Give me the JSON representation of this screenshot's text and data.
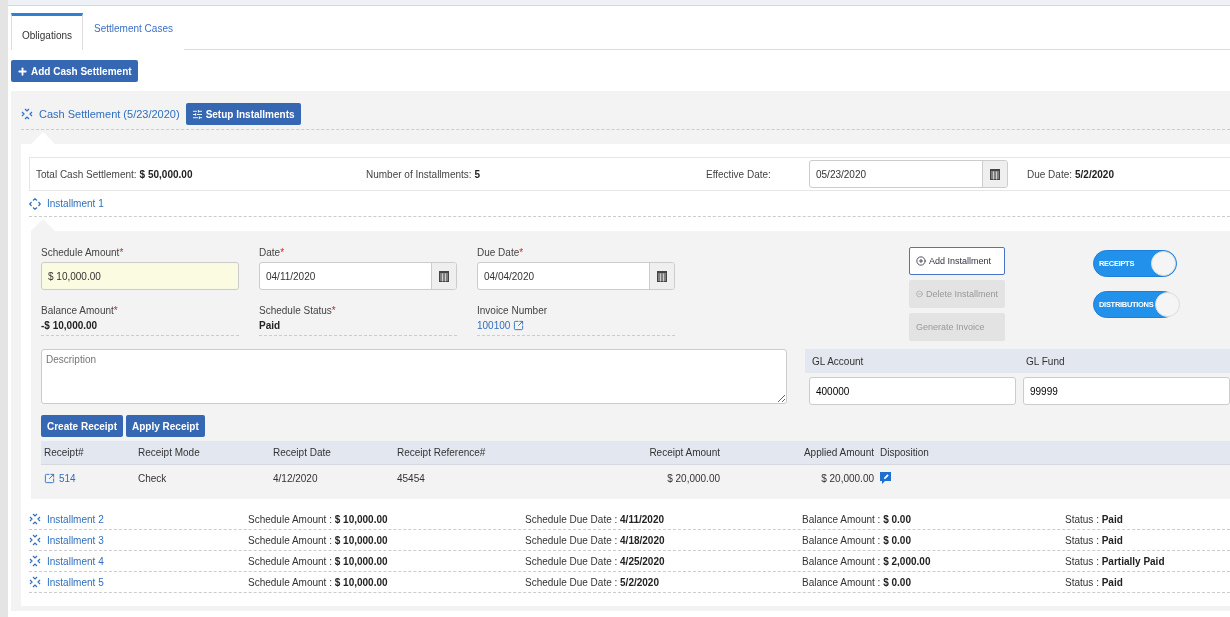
{
  "tabs": [
    {
      "label": "Obligations",
      "selected": true
    },
    {
      "label": "Settlement Cases",
      "selected": false
    }
  ],
  "add_button": "Add Cash Settlement",
  "settlement": {
    "title": "Cash Settlement (5/23/2020)",
    "setup_button": "Setup Installments",
    "summary": [
      {
        "kind": "text",
        "label": "Total Cash Settlement:",
        "value": "$ 50,000.00"
      },
      {
        "kind": "text",
        "label": "Number of Installments:",
        "value": "5"
      },
      {
        "kind": "date",
        "label": "Effective Date:",
        "value": "05/23/2020"
      },
      {
        "kind": "text",
        "label": "Due Date:",
        "value": "5/2/2020"
      }
    ]
  },
  "installments": [
    {
      "title": "Installment 1",
      "expanded": true,
      "fields": [
        {
          "kind": "amount",
          "label": "Schedule Amount",
          "required_mark": "*",
          "value": "$ 10,000.00"
        },
        {
          "kind": "date",
          "label": "Date",
          "required_mark": "*",
          "value": "04/11/2020"
        },
        {
          "kind": "date",
          "label": "Due Date",
          "required_mark": "*",
          "value": "04/04/2020"
        },
        {
          "kind": "text",
          "label": "Balance Amount",
          "required_mark": "*",
          "value": "-$ 10,000.00"
        },
        {
          "kind": "text",
          "label": "Schedule Status",
          "required_mark": "*",
          "value": "Paid"
        },
        {
          "kind": "link",
          "label": "Invoice Number",
          "value": "100100"
        }
      ],
      "description_placeholder": "Description",
      "actions": [
        {
          "kind": "add",
          "label": "Add Installment",
          "disabled": false
        },
        {
          "kind": "delete",
          "label": "Delete Installment",
          "disabled": true
        },
        {
          "kind": "plain",
          "label": "Generate Invoice",
          "disabled": true
        }
      ],
      "toggles": [
        {
          "label": "RECEIPTS",
          "on": true
        },
        {
          "label": "DISTRIBUTIONS",
          "on": true
        }
      ],
      "gl": {
        "columns": [
          "GL Account",
          "GL Fund"
        ],
        "values": [
          "400000",
          "99999"
        ]
      },
      "receipt_buttons": [
        "Create Receipt",
        "Apply Receipt"
      ],
      "receipt_columns": [
        "Receipt#",
        "Receipt Mode",
        "Receipt Date",
        "Receipt Reference#",
        "Receipt Amount",
        "Applied Amount",
        "Disposition"
      ],
      "receipts": [
        {
          "number": "514",
          "mode": "Check",
          "date": "4/12/2020",
          "reference": "45454",
          "amount": "$ 20,000.00",
          "applied": "$ 20,000.00"
        }
      ]
    },
    {
      "title": "Installment 2",
      "expanded": false,
      "items": [
        {
          "label": "Schedule Amount :",
          "value": "$ 10,000.00"
        },
        {
          "label": "Schedule Due Date :",
          "value": "4/11/2020"
        },
        {
          "label": "Balance Amount :",
          "value": "$ 0.00"
        },
        {
          "label": "Status :",
          "value": "Paid"
        }
      ]
    },
    {
      "title": "Installment 3",
      "expanded": false,
      "items": [
        {
          "label": "Schedule Amount :",
          "value": "$ 10,000.00"
        },
        {
          "label": "Schedule Due Date :",
          "value": "4/18/2020"
        },
        {
          "label": "Balance Amount :",
          "value": "$ 0.00"
        },
        {
          "label": "Status :",
          "value": "Paid"
        }
      ]
    },
    {
      "title": "Installment 4",
      "expanded": false,
      "items": [
        {
          "label": "Schedule Amount :",
          "value": "$ 10,000.00"
        },
        {
          "label": "Schedule Due Date :",
          "value": "4/25/2020"
        },
        {
          "label": "Balance Amount :",
          "value": "$ 2,000.00"
        },
        {
          "label": "Status :",
          "value": "Partially Paid"
        }
      ]
    },
    {
      "title": "Installment 5",
      "expanded": false,
      "items": [
        {
          "label": "Schedule Amount :",
          "value": "$ 10,000.00"
        },
        {
          "label": "Schedule Due Date :",
          "value": "5/2/2020"
        },
        {
          "label": "Balance Amount :",
          "value": "$ 0.00"
        },
        {
          "label": "Status :",
          "value": "Paid"
        }
      ]
    }
  ]
}
